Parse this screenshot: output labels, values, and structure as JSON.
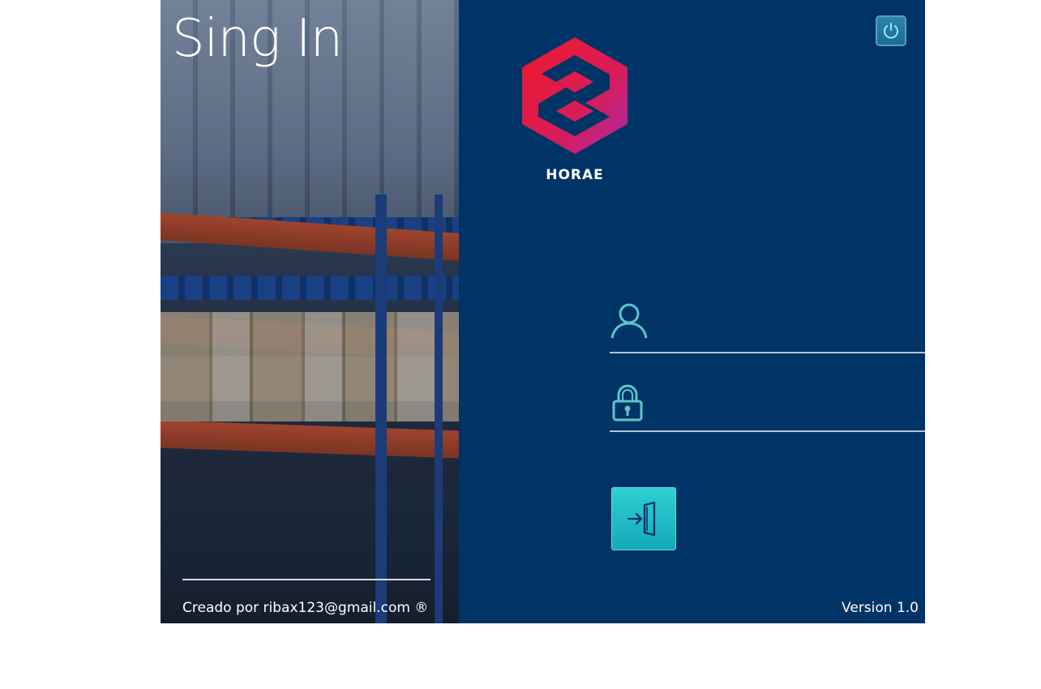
{
  "left_panel": {
    "title": "Sing In",
    "creator": "Creado por ribax123@gmail.com ®"
  },
  "right_panel": {
    "brand_name": "HORAE",
    "version": "Version 1.0",
    "username_field": {
      "value": "",
      "icon": "user-icon"
    },
    "password_field": {
      "value": "",
      "icon": "lock-icon"
    },
    "login_button_icon": "enter-door-icon",
    "power_button_icon": "power-icon"
  },
  "colors": {
    "panel_bg": "#003366",
    "accent_teal": "#1fbfc6",
    "logo_gradient_start": "#e8162c",
    "logo_gradient_end": "#b42a9e"
  }
}
